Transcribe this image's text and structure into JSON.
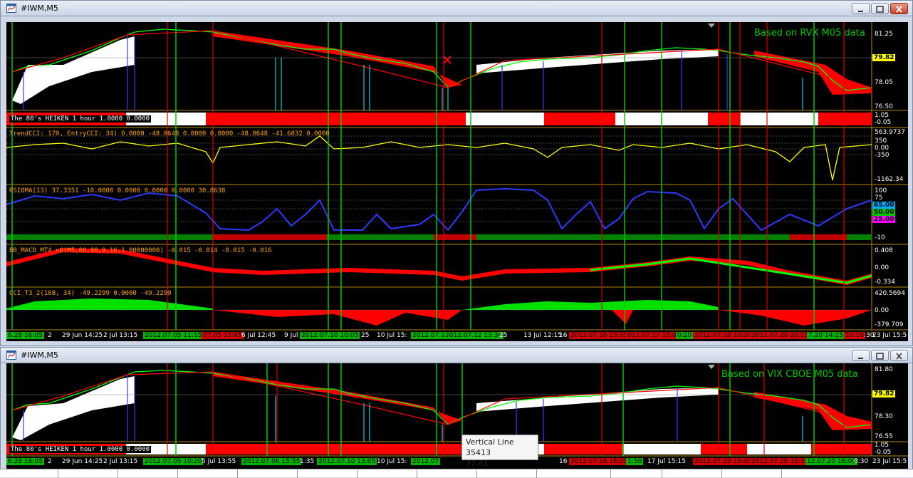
{
  "window1": {
    "title": "#IWM,M5",
    "source_label": "Based on RVX M05 data",
    "heiken_label": "The 80's HEIKEN 1 hour 1.0000 0.0000",
    "cci_label": "TrendCCI: 170, EntryCCI: 34) 0.0000 -48.0648 0.0000 0.0000 -48.0648 -41.6832 0.0000",
    "rsioma_label": "RSIOMA(13) 37.3351 -10.0000 0.0000 0.0000 0.0000 30.8638",
    "macd_label": "BB_MACD_MT4_v6(M5,60,90,9,16,1.00000000) -0.015 -0.014 -0.015 -0.016",
    "cci2_label": "CCI_T3_2(168, 34) -49.2299 0.0000 -49.2299",
    "price_axis": [
      "81.25",
      "78.05",
      "76.50"
    ],
    "price_tag": "79.82",
    "heiken_axis": [
      "1.05",
      "-0.05"
    ],
    "cci_axis": [
      "563.9737",
      "350",
      "0.00",
      "-350",
      "-1162.34"
    ],
    "rsioma_axis": [
      "100",
      "75",
      "65.00",
      "50.00",
      "25",
      "-10"
    ],
    "rsioma_tags": [
      "65.00",
      "50.00",
      "25.00"
    ],
    "macd_axis": [
      "0.408",
      "0.00",
      "-0.334"
    ],
    "cci2_axis": [
      "420.5694",
      "0.00",
      "-379.709"
    ],
    "time_labels": [
      {
        "text": "6.28 16:05",
        "style": "green"
      },
      {
        "text": "2",
        "style": "plain"
      },
      {
        "text": "29 Jun 14:25",
        "style": "plain"
      },
      {
        "text": "2 Jul 13:15",
        "style": "plain"
      },
      {
        "text": "2012.07.05 11:15",
        "style": "green"
      },
      {
        "text": "07.05 15:45",
        "style": "red"
      },
      {
        "text": "6 Jul 12:45",
        "style": "plain"
      },
      {
        "text": "9 Jul",
        "style": "plain"
      },
      {
        "text": "2012.07.10 10:05",
        "style": "green"
      },
      {
        "text": "25",
        "style": "plain"
      },
      {
        "text": "10 Jul 15:",
        "style": "plain"
      },
      {
        "text": "2012.07.11",
        "style": "green"
      },
      {
        "text": "2012.07.12 13:30",
        "style": "green"
      },
      {
        "text": "25",
        "style": "plain"
      },
      {
        "text": "13 Jul 12:15",
        "style": "plain"
      },
      {
        "text": "16",
        "style": "plain"
      },
      {
        "text": "2012.07.16 15:35",
        "style": "red"
      },
      {
        "text": "012.07.17 15:00",
        "style": "red"
      },
      {
        "text": "0:20",
        "style": "green"
      },
      {
        "text": "2012.07.19 10:20",
        "style": "red"
      },
      {
        "text": "2012.07.20 10:15",
        "style": "red"
      },
      {
        "text": "7.20 14:15",
        "style": "green"
      },
      {
        "text": "10:10",
        "style": "red"
      },
      {
        "text": ":30",
        "style": "plain"
      },
      {
        "text": "23 Jul 15:5",
        "style": "plain"
      }
    ]
  },
  "window2": {
    "title": "#IWM,M5",
    "source_label": "Based on VIX CBOE M05 data",
    "heiken_label": "The 80's HEIKEN 1 hour 1.0000 0.0000",
    "price_axis": [
      "81.80",
      "78.30",
      "76.55"
    ],
    "price_tag": "79.82",
    "heiken_axis": [
      "1.05",
      "-0.05"
    ],
    "time_labels": [
      {
        "text": "6.28 16:05",
        "style": "green"
      },
      {
        "text": "2",
        "style": "plain"
      },
      {
        "text": "29 Jun 14:25",
        "style": "plain"
      },
      {
        "text": "2 Jul 13:15",
        "style": "plain"
      },
      {
        "text": "2012.07.05 10:20",
        "style": "green"
      },
      {
        "text": "5 Jul 13:55",
        "style": "plain"
      },
      {
        "text": "2012.07.06 15:55",
        "style": "green"
      },
      {
        "text": "1:35",
        "style": "plain"
      },
      {
        "text": "2012.07.10 13:05",
        "style": "green"
      },
      {
        "text": "10 Jul 15:",
        "style": "plain"
      },
      {
        "text": "2012.07",
        "style": "green"
      },
      {
        "text": "16",
        "style": "plain"
      },
      {
        "text": "2012.07.16 16:05",
        "style": "red"
      },
      {
        "text": "1:30",
        "style": "green"
      },
      {
        "text": "17 Jul 15:15",
        "style": "plain"
      },
      {
        "text": "2012.07.19 10:45",
        "style": "red"
      },
      {
        "text": "2012.07.20 10:35",
        "style": "red"
      },
      {
        "text": "12.07.20 16:00",
        "style": "green"
      },
      {
        "text": "0:30",
        "style": "plain"
      },
      {
        "text": "23 Jul 15:5",
        "style": "plain"
      }
    ],
    "tooltip": {
      "line1": "Vertical Line 35413",
      "line2": "77.41"
    }
  },
  "colors": {
    "background": "#000000",
    "bull": "#00ff00",
    "bear": "#ff0000",
    "accent": "#ffff00",
    "vline_green": "#00c800",
    "vline_red": "#e00000",
    "vline_blue": "#3a3aff",
    "vline_cyan": "#00ffff",
    "label_orange": "#ffa500"
  }
}
